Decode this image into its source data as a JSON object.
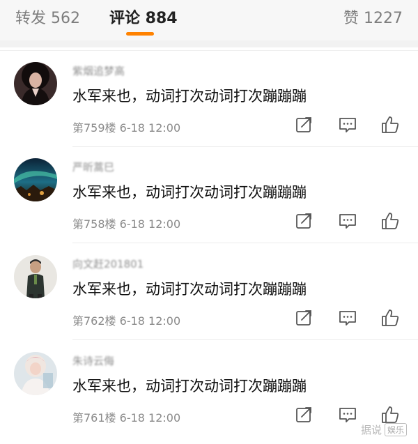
{
  "tabs": {
    "repost": "转发 562",
    "comments": "评论 884",
    "likes": "赞 1227"
  },
  "comments": [
    {
      "username": "紫烟追梦高",
      "text": "水军来也，动词打次动词打次蹦蹦蹦",
      "floor": "第759楼",
      "time": "6-18 12:00"
    },
    {
      "username": "严昕蒿巳",
      "text": "水军来也，动词打次动词打次蹦蹦蹦",
      "floor": "第758楼",
      "time": "6-18 12:00"
    },
    {
      "username": "向文赶201801",
      "text": "水军来也，动词打次动词打次蹦蹦蹦",
      "floor": "第762楼",
      "time": "6-18 12:00"
    },
    {
      "username": "朱诗云侮",
      "text": "水军来也，动词打次动词打次蹦蹦蹦",
      "floor": "第761楼",
      "time": "6-18 12:00"
    }
  ],
  "icons": {
    "share": "share-icon",
    "reply": "comment-icon",
    "like": "thumbs-up-icon"
  },
  "colors": {
    "accent": "#ff8200",
    "text": "#111111",
    "muted": "#8a8a8a"
  },
  "watermark": {
    "main": "据说",
    "box": "娱乐"
  }
}
